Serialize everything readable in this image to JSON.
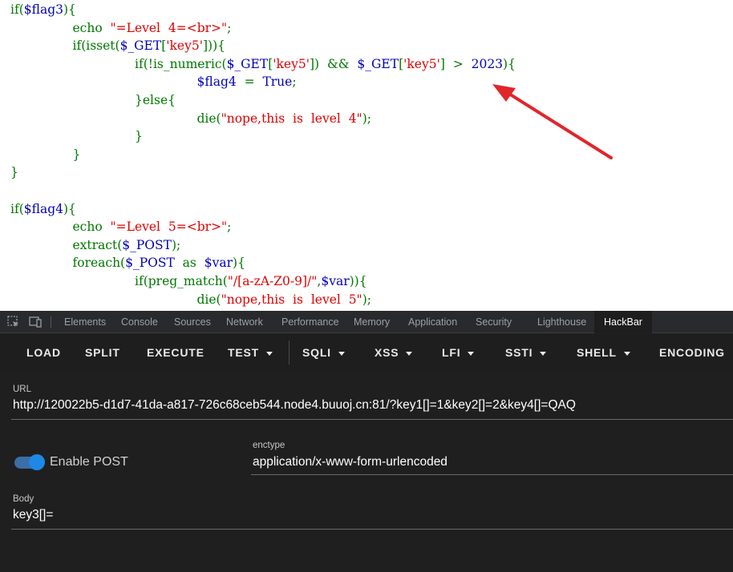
{
  "code": {
    "lines": [
      [
        [
          "kw",
          "if("
        ],
        [
          "var",
          "$flag3"
        ],
        [
          "kw",
          "){"
        ]
      ],
      [
        [
          "kw",
          "echo  "
        ],
        [
          "str",
          "\"=Level  4=<br>\""
        ],
        [
          "kw",
          ";"
        ]
      ],
      [
        [
          "kw",
          "if(isset("
        ],
        [
          "var",
          "$_GET"
        ],
        [
          "kw",
          "["
        ],
        [
          "str",
          "'key5'"
        ],
        [
          "kw",
          "])){"
        ]
      ],
      [
        [
          "kw",
          "if(!is_numeric("
        ],
        [
          "var",
          "$_GET"
        ],
        [
          "kw",
          "["
        ],
        [
          "str",
          "'key5'"
        ],
        [
          "kw",
          "])  &&  "
        ],
        [
          "var",
          "$_GET"
        ],
        [
          "kw",
          "["
        ],
        [
          "str",
          "'key5'"
        ],
        [
          "kw",
          "]  >  "
        ],
        [
          "var",
          "2023"
        ],
        [
          "kw",
          "){"
        ]
      ],
      [
        [
          "var",
          "$flag4"
        ],
        [
          "kw",
          "  =  "
        ],
        [
          "var",
          "True"
        ],
        [
          "kw",
          ";"
        ]
      ],
      [
        [
          "kw",
          "}else{"
        ]
      ],
      [
        [
          "kw",
          "die("
        ],
        [
          "str",
          "\"nope,this  is  level  4\""
        ],
        [
          "kw",
          ");"
        ]
      ],
      [
        [
          "kw",
          "}"
        ]
      ],
      [
        [
          "kw",
          "}"
        ]
      ],
      [
        [
          "kw",
          "}"
        ]
      ],
      [],
      [
        [
          "kw",
          "if("
        ],
        [
          "var",
          "$flag4"
        ],
        [
          "kw",
          "){"
        ]
      ],
      [
        [
          "kw",
          "echo  "
        ],
        [
          "str",
          "\"=Level  5=<br>\""
        ],
        [
          "kw",
          ";"
        ]
      ],
      [
        [
          "kw",
          "extract("
        ],
        [
          "var",
          "$_POST"
        ],
        [
          "kw",
          ");"
        ]
      ],
      [
        [
          "kw",
          "foreach("
        ],
        [
          "var",
          "$_POST"
        ],
        [
          "kw",
          "  as  "
        ],
        [
          "var",
          "$var"
        ],
        [
          "kw",
          "){"
        ]
      ],
      [
        [
          "kw",
          "if(preg_match("
        ],
        [
          "str",
          "\"/[a-zA-Z0-9]/\""
        ],
        [
          "kw",
          ","
        ],
        [
          "var",
          "$var"
        ],
        [
          "kw",
          "))"
        ],
        [
          "kw",
          "{"
        ]
      ],
      [
        [
          "kw",
          "die("
        ],
        [
          "str",
          "\"nope,this  is  level  5\""
        ],
        [
          "kw",
          ");"
        ]
      ]
    ]
  },
  "devtools": {
    "tabs": [
      "Elements",
      "Console",
      "Sources",
      "Network",
      "Performance",
      "Memory",
      "Application",
      "Security",
      "Lighthouse",
      "HackBar"
    ],
    "active_tab": "HackBar"
  },
  "hackbar": {
    "toolbar": {
      "load": "LOAD",
      "split": "SPLIT",
      "execute": "EXECUTE",
      "test": "TEST",
      "sqli": "SQLI",
      "xss": "XSS",
      "lfi": "LFI",
      "ssti": "SSTI",
      "shell": "SHELL",
      "encoding": "ENCODING"
    },
    "url_label": "URL",
    "url_value": "http://120022b5-d1d7-41da-a817-726c68ceb544.node4.buuoj.cn:81/?key1[]=1&key2[]=2&key4[]=QAQ",
    "enable_post_label": "Enable POST",
    "enable_post": true,
    "enctype_label": "enctype",
    "enctype_value": "application/x-www-form-urlencoded",
    "body_label": "Body",
    "body_value": "key3[]="
  },
  "colors": {
    "keyword": "#007700",
    "variable": "#0000bb",
    "string": "#dd0000",
    "arrow": "#e0262b",
    "toggle": "#1e88e5"
  }
}
